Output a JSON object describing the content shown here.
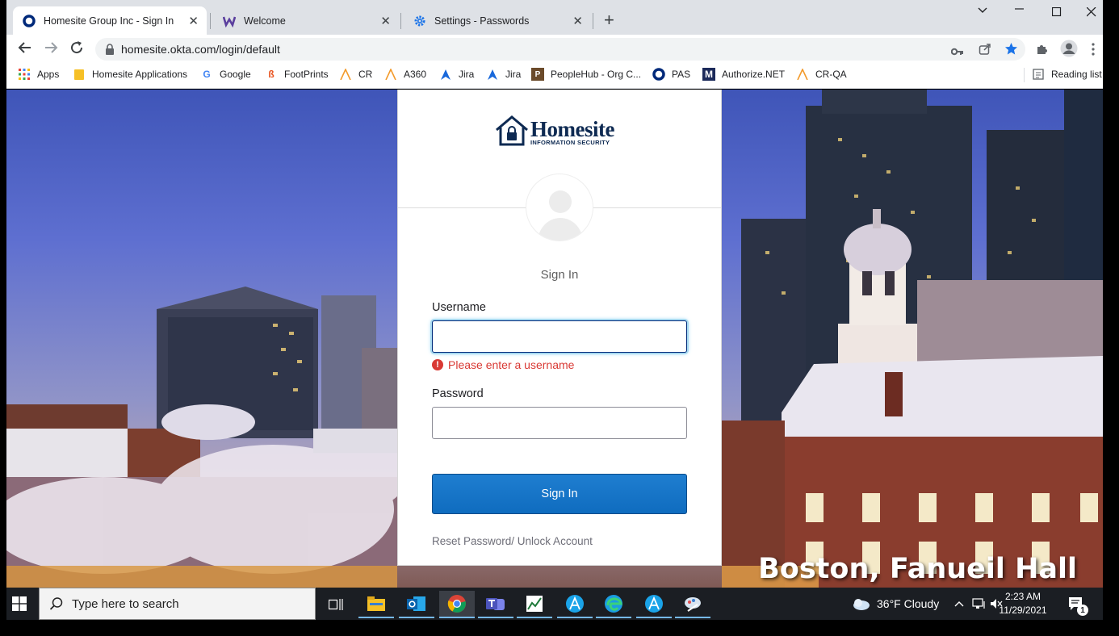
{
  "browser": {
    "tabs": [
      {
        "title": "Homesite Group Inc - Sign In",
        "active": true,
        "icon": "okta-icon"
      },
      {
        "title": "Welcome",
        "active": false,
        "icon": "w-logo-icon"
      },
      {
        "title": "Settings - Passwords",
        "active": false,
        "icon": "settings-gear-icon"
      }
    ],
    "url": "homesite.okta.com/login/default",
    "bookmarks": [
      "Apps",
      "Homesite Applications",
      "Google",
      "FootPrints",
      "CR",
      "A360",
      "Jira",
      "Jira",
      "PeopleHub - Org C...",
      "PAS",
      "Authorize.NET",
      "CR-QA"
    ],
    "reading_list": "Reading list"
  },
  "login": {
    "logo_word": "Homesite",
    "logo_sub": "INFORMATION SECURITY",
    "title": "Sign In",
    "username_label": "Username",
    "username_value": "",
    "error": "Please enter a username",
    "password_label": "Password",
    "password_value": "",
    "signin_button": "Sign In",
    "reset_link": "Reset Password/ Unlock Account"
  },
  "background_caption": "Boston, Fanueil Hall",
  "taskbar": {
    "search_placeholder": "Type here to search",
    "weather": "36°F  Cloudy",
    "time": "2:23 AM",
    "date": "11/29/2021",
    "notifications": "1"
  },
  "colors": {
    "accent_blue": "#1662dd",
    "error_red": "#d93934",
    "brand_navy": "#0e2a52"
  }
}
